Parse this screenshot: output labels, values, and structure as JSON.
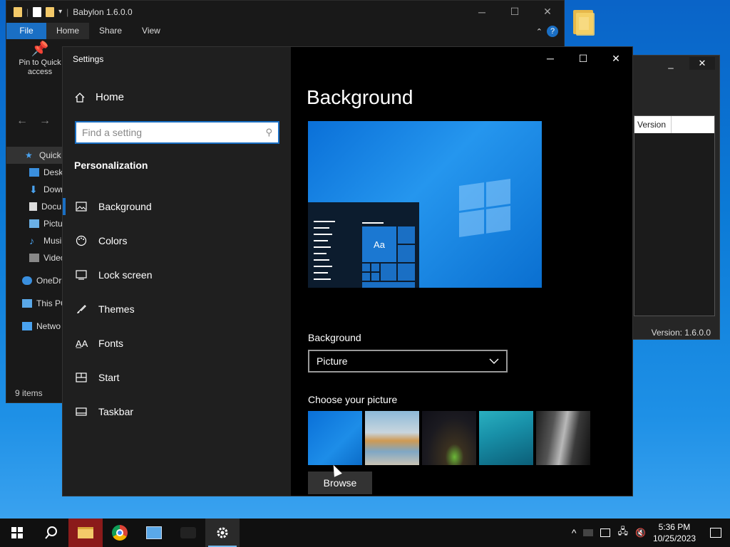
{
  "explorer": {
    "title": "Babylon 1.6.0.0",
    "tabs": [
      "File",
      "Home",
      "Share",
      "View"
    ],
    "pin_label": "Pin to Quick access",
    "tree": [
      "Quick",
      "Deskt",
      "Down",
      "Docu",
      "Pictu",
      "Musi",
      "Video",
      "OneDr",
      "This PC",
      "Netwo"
    ],
    "status": "9 items"
  },
  "babylon": {
    "column": "Version",
    "status": "Version: 1.6.0.0"
  },
  "settings": {
    "title": "Settings",
    "home_label": "Home",
    "search_placeholder": "Find a setting",
    "section": "Personalization",
    "nav": [
      {
        "label": "Background",
        "icon": "picture-icon"
      },
      {
        "label": "Colors",
        "icon": "palette-icon"
      },
      {
        "label": "Lock screen",
        "icon": "lock-screen-icon"
      },
      {
        "label": "Themes",
        "icon": "themes-icon"
      },
      {
        "label": "Fonts",
        "icon": "fonts-icon"
      },
      {
        "label": "Start",
        "icon": "start-icon"
      },
      {
        "label": "Taskbar",
        "icon": "taskbar-icon"
      }
    ],
    "page_title": "Background",
    "preview_tile_text": "Aa",
    "background_label": "Background",
    "background_value": "Picture",
    "choose_label": "Choose your picture",
    "browse_label": "Browse"
  },
  "taskbar": {
    "time": "5:36 PM",
    "date": "10/25/2023"
  },
  "colors": {
    "accent": "#1a6fc4",
    "settings_left_bg": "#1f1f1f",
    "settings_right_bg": "#000000",
    "desktop": "#0b7ad6"
  }
}
